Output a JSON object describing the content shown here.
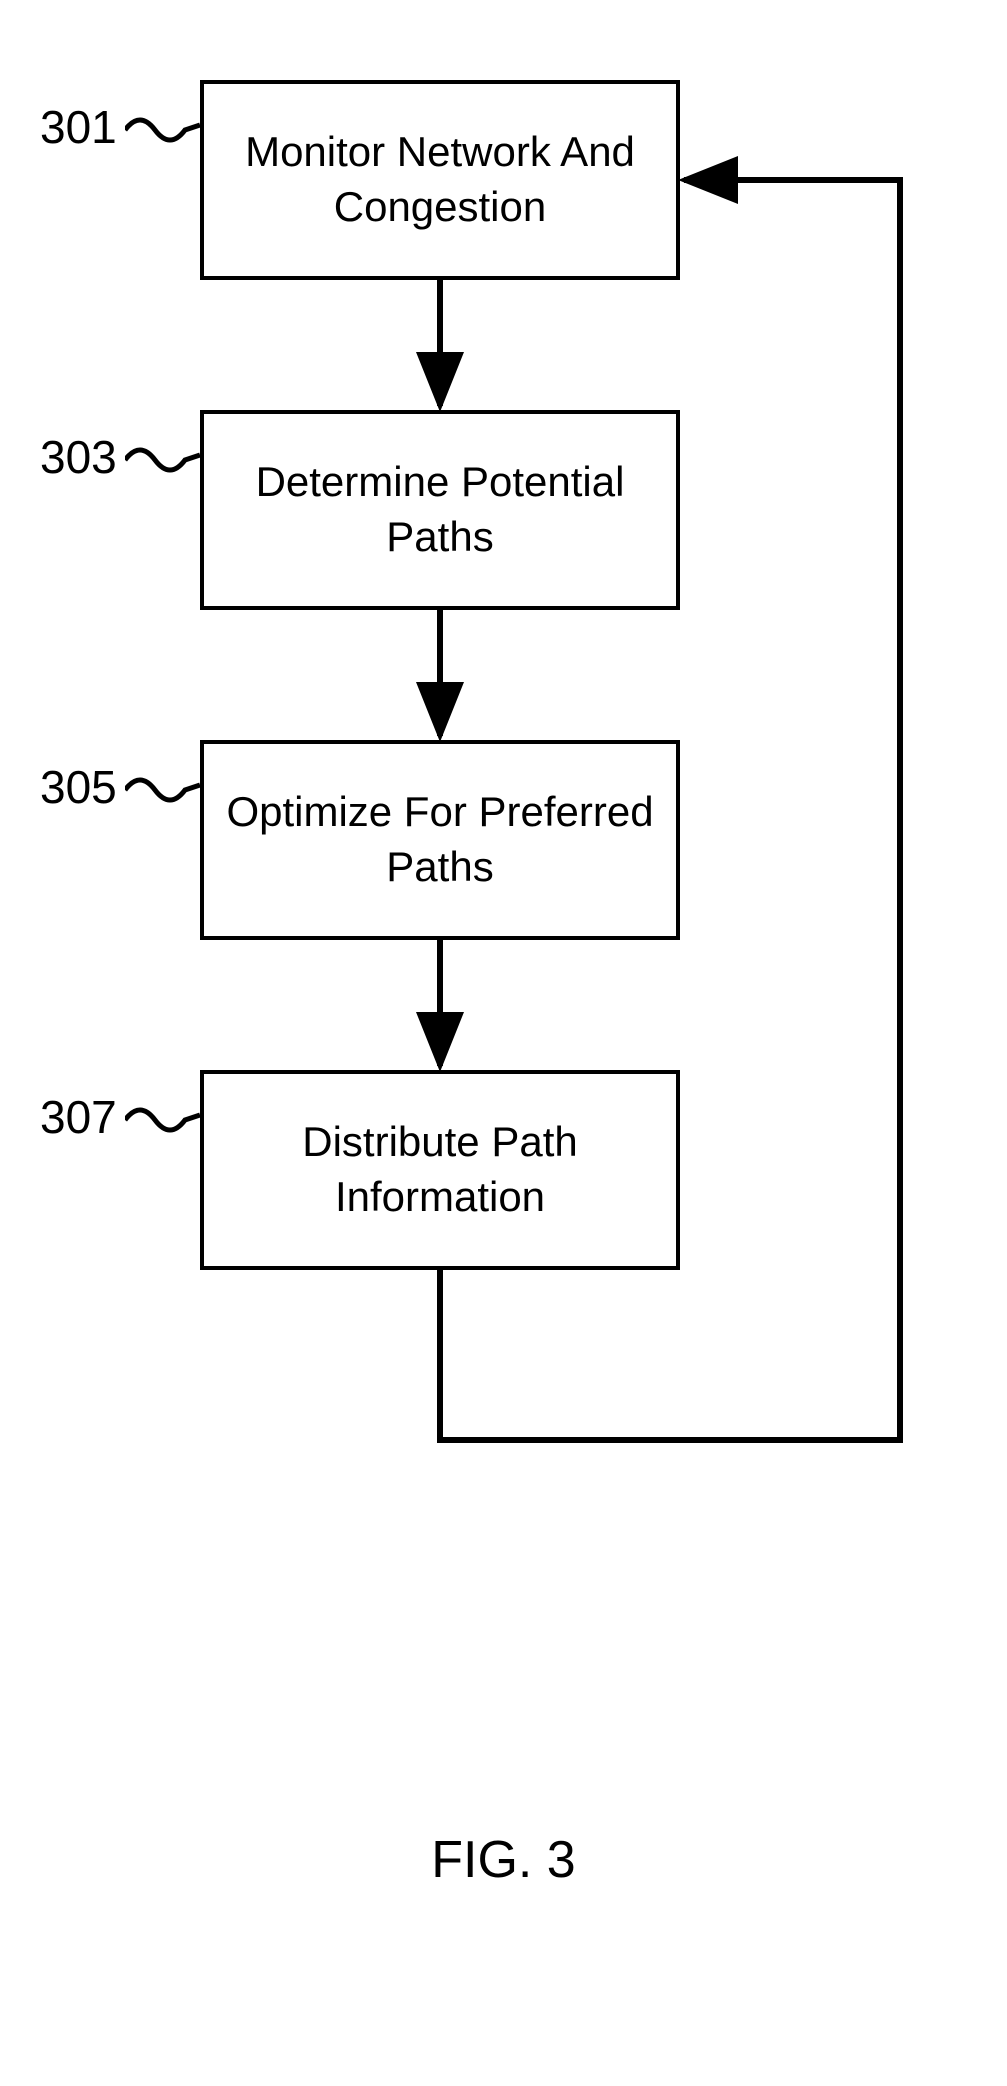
{
  "steps": [
    {
      "num": "301",
      "text": "Monitor Network And Congestion"
    },
    {
      "num": "303",
      "text": "Determine Potential Paths"
    },
    {
      "num": "305",
      "text": "Optimize For Preferred Paths"
    },
    {
      "num": "307",
      "text": "Distribute Path Information"
    }
  ],
  "figure_caption": "FIG. 3"
}
